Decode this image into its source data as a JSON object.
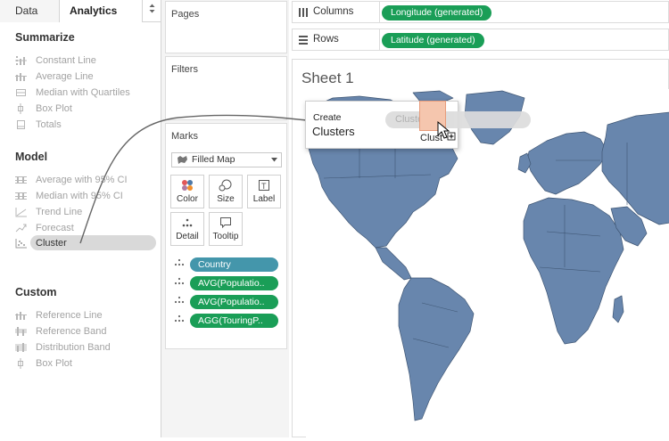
{
  "tabs": {
    "data": "Data",
    "analytics": "Analytics",
    "menu_arrow": "▲▼"
  },
  "analytics": {
    "summarize": {
      "title": "Summarize",
      "items": [
        "Constant Line",
        "Average Line",
        "Median with Quartiles",
        "Box Plot",
        "Totals"
      ]
    },
    "model": {
      "title": "Model",
      "items": [
        "Average with 95% CI",
        "Median with 95% CI",
        "Trend Line",
        "Forecast",
        "Cluster"
      ]
    },
    "custom": {
      "title": "Custom",
      "items": [
        "Reference Line",
        "Reference Band",
        "Distribution Band",
        "Box Plot"
      ]
    }
  },
  "cards": {
    "pages": "Pages",
    "filters": "Filters",
    "marks": {
      "title": "Marks",
      "mark_type": "Filled Map",
      "buttons": [
        "Color",
        "Size",
        "Label",
        "Detail",
        "Tooltip"
      ],
      "pills": [
        {
          "label": "Country",
          "color": "#4496ab"
        },
        {
          "label": "AVG(Populatio..",
          "color": "#1a9e57"
        },
        {
          "label": "AVG(Populatio..",
          "color": "#1a9e57"
        },
        {
          "label": "AGG(TouringP..",
          "color": "#1a9e57"
        }
      ]
    }
  },
  "shelves": {
    "columns": {
      "label": "Columns",
      "pill": "Longitude (generated)"
    },
    "rows": {
      "label": "Rows",
      "pill": "Latitude (generated)"
    }
  },
  "sheet": {
    "title": "Sheet 1"
  },
  "tooltip": {
    "line1": "Create",
    "line2": "Clusters",
    "ghost_pill": "Cluster",
    "drag_label": "Clust"
  },
  "colors": {
    "map_fill": "#6886ad",
    "pill_green": "#1a9e57",
    "pill_blue": "#4496ab",
    "drop_target": "#f5c6ae"
  }
}
